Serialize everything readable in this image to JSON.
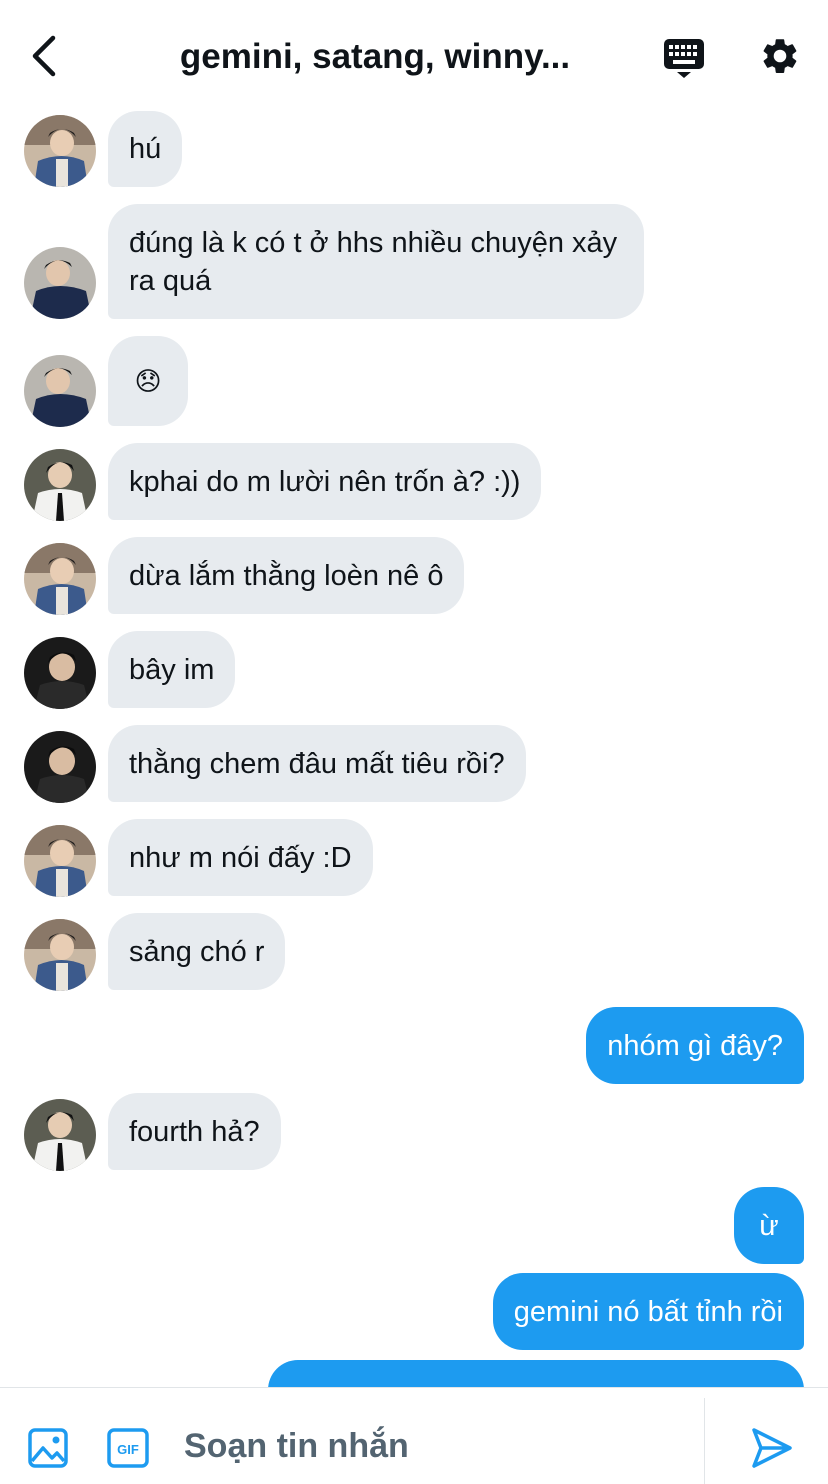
{
  "header": {
    "title": "gemini, satang, winny...",
    "back_icon": "chevron-left-icon",
    "keyboard_icon": "keyboard-icon",
    "settings_icon": "gear-icon"
  },
  "messages": [
    {
      "text": "hú",
      "direction": "in",
      "avatar": "avatar-a"
    },
    {
      "text": "đúng là k có t ở hhs nhiều chuyện xảy ra quá",
      "direction": "in",
      "avatar": "avatar-b"
    },
    {
      "text": "😞",
      "direction": "in",
      "avatar": "avatar-b"
    },
    {
      "text": "kphai do m lười nên trốn à? :))",
      "direction": "in",
      "avatar": "avatar-c"
    },
    {
      "text": "dừa lắm thằng loèn nê ô",
      "direction": "in",
      "avatar": "avatar-a"
    },
    {
      "text": "bây im",
      "direction": "in",
      "avatar": "avatar-d"
    },
    {
      "text": "thằng chem đâu mất tiêu rồi?",
      "direction": "in",
      "avatar": "avatar-d"
    },
    {
      "text": "như m nói đấy :D",
      "direction": "in",
      "avatar": "avatar-a"
    },
    {
      "text": "sảng chó r",
      "direction": "in",
      "avatar": "avatar-a"
    },
    {
      "text": "nhóm gì đây?",
      "direction": "out"
    },
    {
      "text": "fourth hả?",
      "direction": "in",
      "avatar": "avatar-c"
    },
    {
      "text": "ừ",
      "direction": "out"
    },
    {
      "text": "gemini nó bất tỉnh rồi",
      "direction": "out"
    }
  ],
  "composer": {
    "placeholder": "Soạn tin nhắn",
    "gif_label": "GIF",
    "media_icon": "image-icon",
    "gif_icon": "gif-icon",
    "send_icon": "send-icon"
  },
  "colors": {
    "accent": "#1d9bf0",
    "incoming_bubble": "#e7ebef",
    "text": "#0f1419",
    "muted": "#536471"
  }
}
